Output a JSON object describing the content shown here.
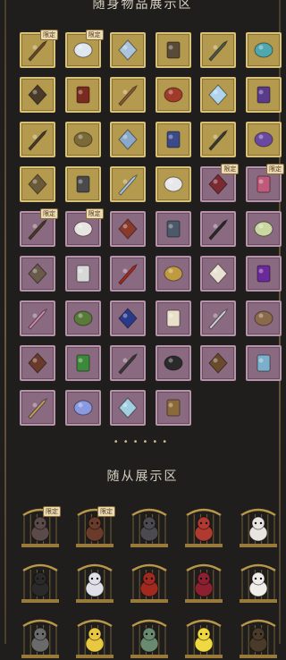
{
  "sections": {
    "items_title": "随身物品展示区",
    "companions_title": "随从展示区",
    "page_dots": "••••••"
  },
  "badge_text": "限定",
  "items": [
    {
      "tier": "gold",
      "icon": "bird-ornament-icon",
      "badge": true,
      "color": "#6b4a2a"
    },
    {
      "tier": "gold",
      "icon": "winged-creature-icon",
      "badge": true,
      "color": "#dfe6f0"
    },
    {
      "tier": "gold",
      "icon": "butterfly-icon",
      "badge": false,
      "color": "#a9c4dc"
    },
    {
      "tier": "gold",
      "icon": "book-icon",
      "badge": false,
      "color": "#5a4a3a"
    },
    {
      "tier": "gold",
      "icon": "staff-icon",
      "badge": false,
      "color": "#4a5a4a"
    },
    {
      "tier": "gold",
      "icon": "tentacle-icon",
      "badge": false,
      "color": "#4fa8b0"
    },
    {
      "tier": "gold",
      "icon": "sword-icon",
      "badge": false,
      "color": "#4a3a2a"
    },
    {
      "tier": "gold",
      "icon": "crossbow-icon",
      "badge": false,
      "color": "#7a2a1e"
    },
    {
      "tier": "gold",
      "icon": "mechanism-icon",
      "badge": false,
      "color": "#8a5a3a"
    },
    {
      "tier": "gold",
      "icon": "flower-bundle-icon",
      "badge": false,
      "color": "#a03a2a"
    },
    {
      "tier": "gold",
      "icon": "crystal-icon",
      "badge": false,
      "color": "#b0d4ee"
    },
    {
      "tier": "gold",
      "icon": "torch-icon",
      "badge": false,
      "color": "#5a3a8a"
    },
    {
      "tier": "gold",
      "icon": "clock-icon",
      "badge": false,
      "color": "#4a3a2a"
    },
    {
      "tier": "gold",
      "icon": "feather-icon",
      "badge": false,
      "color": "#7a6a3a"
    },
    {
      "tier": "gold",
      "icon": "lantern-icon",
      "badge": false,
      "color": "#8aa8cc"
    },
    {
      "tier": "gold",
      "icon": "wand-icon",
      "badge": false,
      "color": "#3a4a8a"
    },
    {
      "tier": "gold",
      "icon": "bell-icon",
      "badge": false,
      "color": "#3a3a3a"
    },
    {
      "tier": "gold",
      "icon": "blue-flame-icon",
      "badge": false,
      "color": "#6a4aa0"
    },
    {
      "tier": "gold",
      "icon": "horn-icon",
      "badge": false,
      "color": "#6a5a3a"
    },
    {
      "tier": "gold",
      "icon": "key-icon",
      "badge": false,
      "color": "#4a4a4a"
    },
    {
      "tier": "gold",
      "icon": "ice-crystal-icon",
      "badge": false,
      "color": "#a8c8e8"
    },
    {
      "tier": "gold",
      "icon": "white-wings-icon",
      "badge": false,
      "color": "#e8e8ea"
    },
    {
      "tier": "purple",
      "icon": "rose-mechanism-icon",
      "badge": true,
      "color": "#7a2a30"
    },
    {
      "tier": "purple",
      "icon": "pink-lantern-icon",
      "badge": true,
      "color": "#c05a7a"
    },
    {
      "tier": "purple",
      "icon": "snake-staff-icon",
      "badge": true,
      "color": "#4a3a2a"
    },
    {
      "tier": "purple",
      "icon": "bandage-icon",
      "badge": true,
      "color": "#e8e4e0"
    },
    {
      "tier": "purple",
      "icon": "scroll-icon",
      "badge": false,
      "color": "#8a3a2a"
    },
    {
      "tier": "purple",
      "icon": "pouch-icon",
      "badge": false,
      "color": "#4a5a6a"
    },
    {
      "tier": "purple",
      "icon": "coffin-icon",
      "badge": false,
      "color": "#2a2a2a"
    },
    {
      "tier": "purple",
      "icon": "potion-icon",
      "badge": false,
      "color": "#c8d8a0"
    },
    {
      "tier": "purple",
      "icon": "hammer-icon",
      "badge": false,
      "color": "#6a5a4a"
    },
    {
      "tier": "purple",
      "icon": "paper-icon",
      "badge": false,
      "color": "#d8d8d8"
    },
    {
      "tier": "purple",
      "icon": "red-gem-icon",
      "badge": false,
      "color": "#b02a1a"
    },
    {
      "tier": "purple",
      "icon": "golden-staff-icon",
      "badge": false,
      "color": "#c09a40"
    },
    {
      "tier": "purple",
      "icon": "white-flower-icon",
      "badge": false,
      "color": "#e8e0d0"
    },
    {
      "tier": "purple",
      "icon": "grape-icon",
      "badge": false,
      "color": "#6a2a9a"
    },
    {
      "tier": "purple",
      "icon": "pink-flask-icon",
      "badge": false,
      "color": "#d08ab0"
    },
    {
      "tier": "purple",
      "icon": "green-book-icon",
      "badge": false,
      "color": "#5a7a3a"
    },
    {
      "tier": "purple",
      "icon": "blue-wand-icon",
      "badge": false,
      "color": "#2a3a8a"
    },
    {
      "tier": "purple",
      "icon": "tusk-icon",
      "badge": false,
      "color": "#e8e0c8"
    },
    {
      "tier": "purple",
      "icon": "silver-ornament-icon",
      "badge": false,
      "color": "#d0d0d8"
    },
    {
      "tier": "purple",
      "icon": "mask-icon",
      "badge": false,
      "color": "#8a6a4a"
    },
    {
      "tier": "purple",
      "icon": "belt-icon",
      "badge": false,
      "color": "#6a3a2a"
    },
    {
      "tier": "purple",
      "icon": "clover-icon",
      "badge": false,
      "color": "#3a8a3a"
    },
    {
      "tier": "purple",
      "icon": "ring-icon",
      "badge": false,
      "color": "#3a3a3a"
    },
    {
      "tier": "purple",
      "icon": "whip-icon",
      "badge": false,
      "color": "#2a2a2a"
    },
    {
      "tier": "purple",
      "icon": "mirror-icon",
      "badge": false,
      "color": "#6a4a2a"
    },
    {
      "tier": "purple",
      "icon": "fish-icon",
      "badge": false,
      "color": "#7ab0cc"
    },
    {
      "tier": "purple",
      "icon": "dagger-icon",
      "badge": false,
      "color": "#c0a060"
    },
    {
      "tier": "purple",
      "icon": "blue-cocoon-icon",
      "badge": false,
      "color": "#8a9ae0"
    },
    {
      "tier": "purple",
      "icon": "ice-shard-icon",
      "badge": false,
      "color": "#a0d0e0"
    },
    {
      "tier": "purple",
      "icon": "crossed-tools-icon",
      "badge": false,
      "color": "#8a6a3a"
    }
  ],
  "companions": [
    {
      "icon": "robot-pet-icon",
      "badge": true,
      "color": "#5a4a4a"
    },
    {
      "icon": "treasure-chest-pet-icon",
      "badge": true,
      "color": "#6a3a2a"
    },
    {
      "icon": "cat-pet-icon",
      "badge": false,
      "color": "#4a4a50"
    },
    {
      "icon": "girl-pet-icon",
      "badge": false,
      "color": "#b03a30"
    },
    {
      "icon": "white-cat-pet-icon",
      "badge": false,
      "color": "#e8e4e0"
    },
    {
      "icon": "panda-pet-icon",
      "badge": false,
      "color": "#2a2a2a"
    },
    {
      "icon": "penguin-pet-icon",
      "badge": false,
      "color": "#e0e0e8"
    },
    {
      "icon": "red-bird-pet-icon",
      "badge": false,
      "color": "#a02a20"
    },
    {
      "icon": "doll-pet-icon",
      "badge": false,
      "color": "#8a2030"
    },
    {
      "icon": "white-dog-pet-icon",
      "badge": false,
      "color": "#f0ece8"
    },
    {
      "icon": "gray-cat-pet-icon",
      "badge": false,
      "color": "#6a6a6a"
    },
    {
      "icon": "duck-pet-icon",
      "badge": false,
      "color": "#e8c840"
    },
    {
      "icon": "frog-pet-icon",
      "badge": false,
      "color": "#6a8a70"
    },
    {
      "icon": "yellow-chick-pet-icon",
      "badge": false,
      "color": "#f0d840"
    },
    {
      "icon": "feather-pet-icon",
      "badge": false,
      "color": "#4a3a2a"
    }
  ]
}
